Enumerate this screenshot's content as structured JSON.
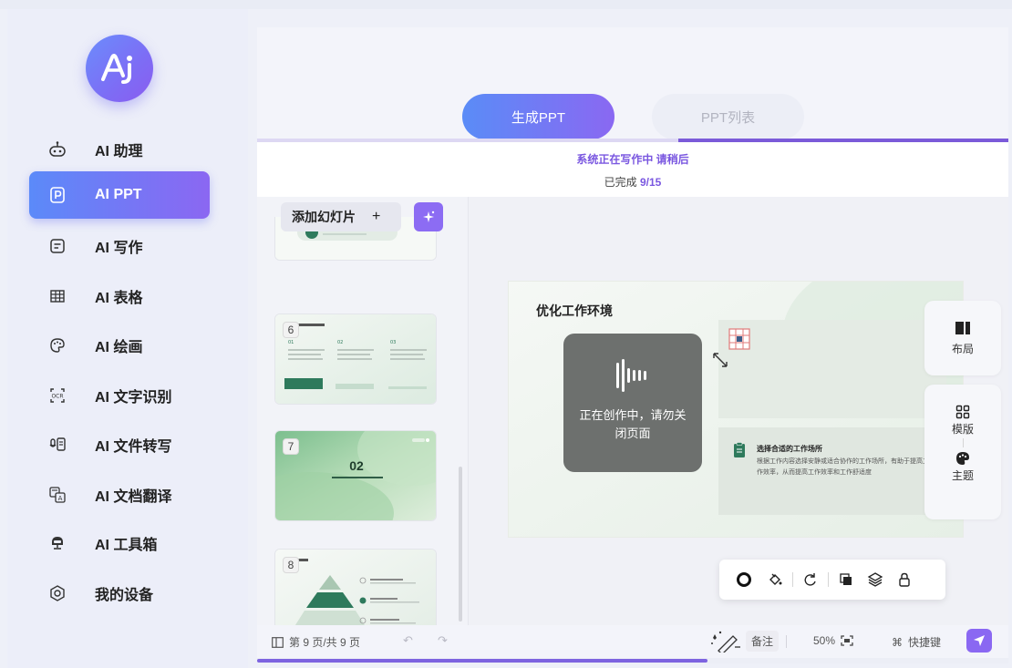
{
  "sidebar": {
    "logo_text": "Ai",
    "items": [
      {
        "label": "AI 助理",
        "icon": "robot-icon"
      },
      {
        "label": "AI PPT",
        "icon": "ppt-icon"
      },
      {
        "label": "AI 写作",
        "icon": "document-icon"
      },
      {
        "label": "AI 表格",
        "icon": "table-icon"
      },
      {
        "label": "AI 绘画",
        "icon": "palette-icon"
      },
      {
        "label": "AI 文字识别",
        "icon": "ocr-icon"
      },
      {
        "label": "AI 文件转写",
        "icon": "mic-doc-icon"
      },
      {
        "label": "AI 文档翻译",
        "icon": "translate-icon"
      },
      {
        "label": "AI 工具箱",
        "icon": "toolbox-icon"
      },
      {
        "label": "我的设备",
        "icon": "device-icon"
      }
    ],
    "active_index": 1
  },
  "tabs": {
    "generate": "生成PPT",
    "list": "PPT列表"
  },
  "status": {
    "line1": "系统正在写作中 请稍后",
    "done_prefix": "已完成 ",
    "done_value": "9/15"
  },
  "slides_panel": {
    "add_label": "添加幻灯片",
    "plus": "+",
    "thumbnails": [
      {
        "num": "6"
      },
      {
        "num": "7",
        "big_text": "02"
      },
      {
        "num": "8"
      }
    ]
  },
  "canvas": {
    "slide_title": "优化工作环境",
    "card_title": "选择合适的工作场所",
    "card_text": "根据工作内容选择安静或适合协作的工作场所，有助于提高工作效率，从而提高工作效率和工作舒适度",
    "overlay_text": "正在创作中，请勿关闭页面"
  },
  "side_tools": {
    "layout": "布局",
    "template": "模版",
    "theme": "主题"
  },
  "statusbar": {
    "page_info": "第 9 页/共 9 页",
    "notes": "备注",
    "zoom": "50%",
    "shortcut": "快捷键"
  },
  "progress": {
    "fraction": 0.6
  },
  "colors": {
    "accent": "#8a68f2",
    "accent_blue": "#5a8cf7"
  }
}
